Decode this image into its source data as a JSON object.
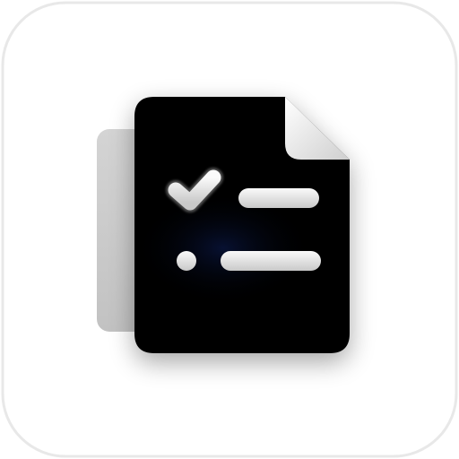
{
  "app_icon": {
    "name": "checklist-document-icon",
    "background_color": "#ffffff",
    "tile_border_color": "#e6e6e6",
    "back_page_color": "#cfcfcf",
    "document_color": "#050505",
    "glow_color": "#0b1a4a",
    "folded_corner_color": "#ececec",
    "mark_color": "#e8e8e8",
    "rows": [
      {
        "marker": "checkmark",
        "state": "checked"
      },
      {
        "marker": "dot",
        "state": "unchecked"
      }
    ]
  }
}
